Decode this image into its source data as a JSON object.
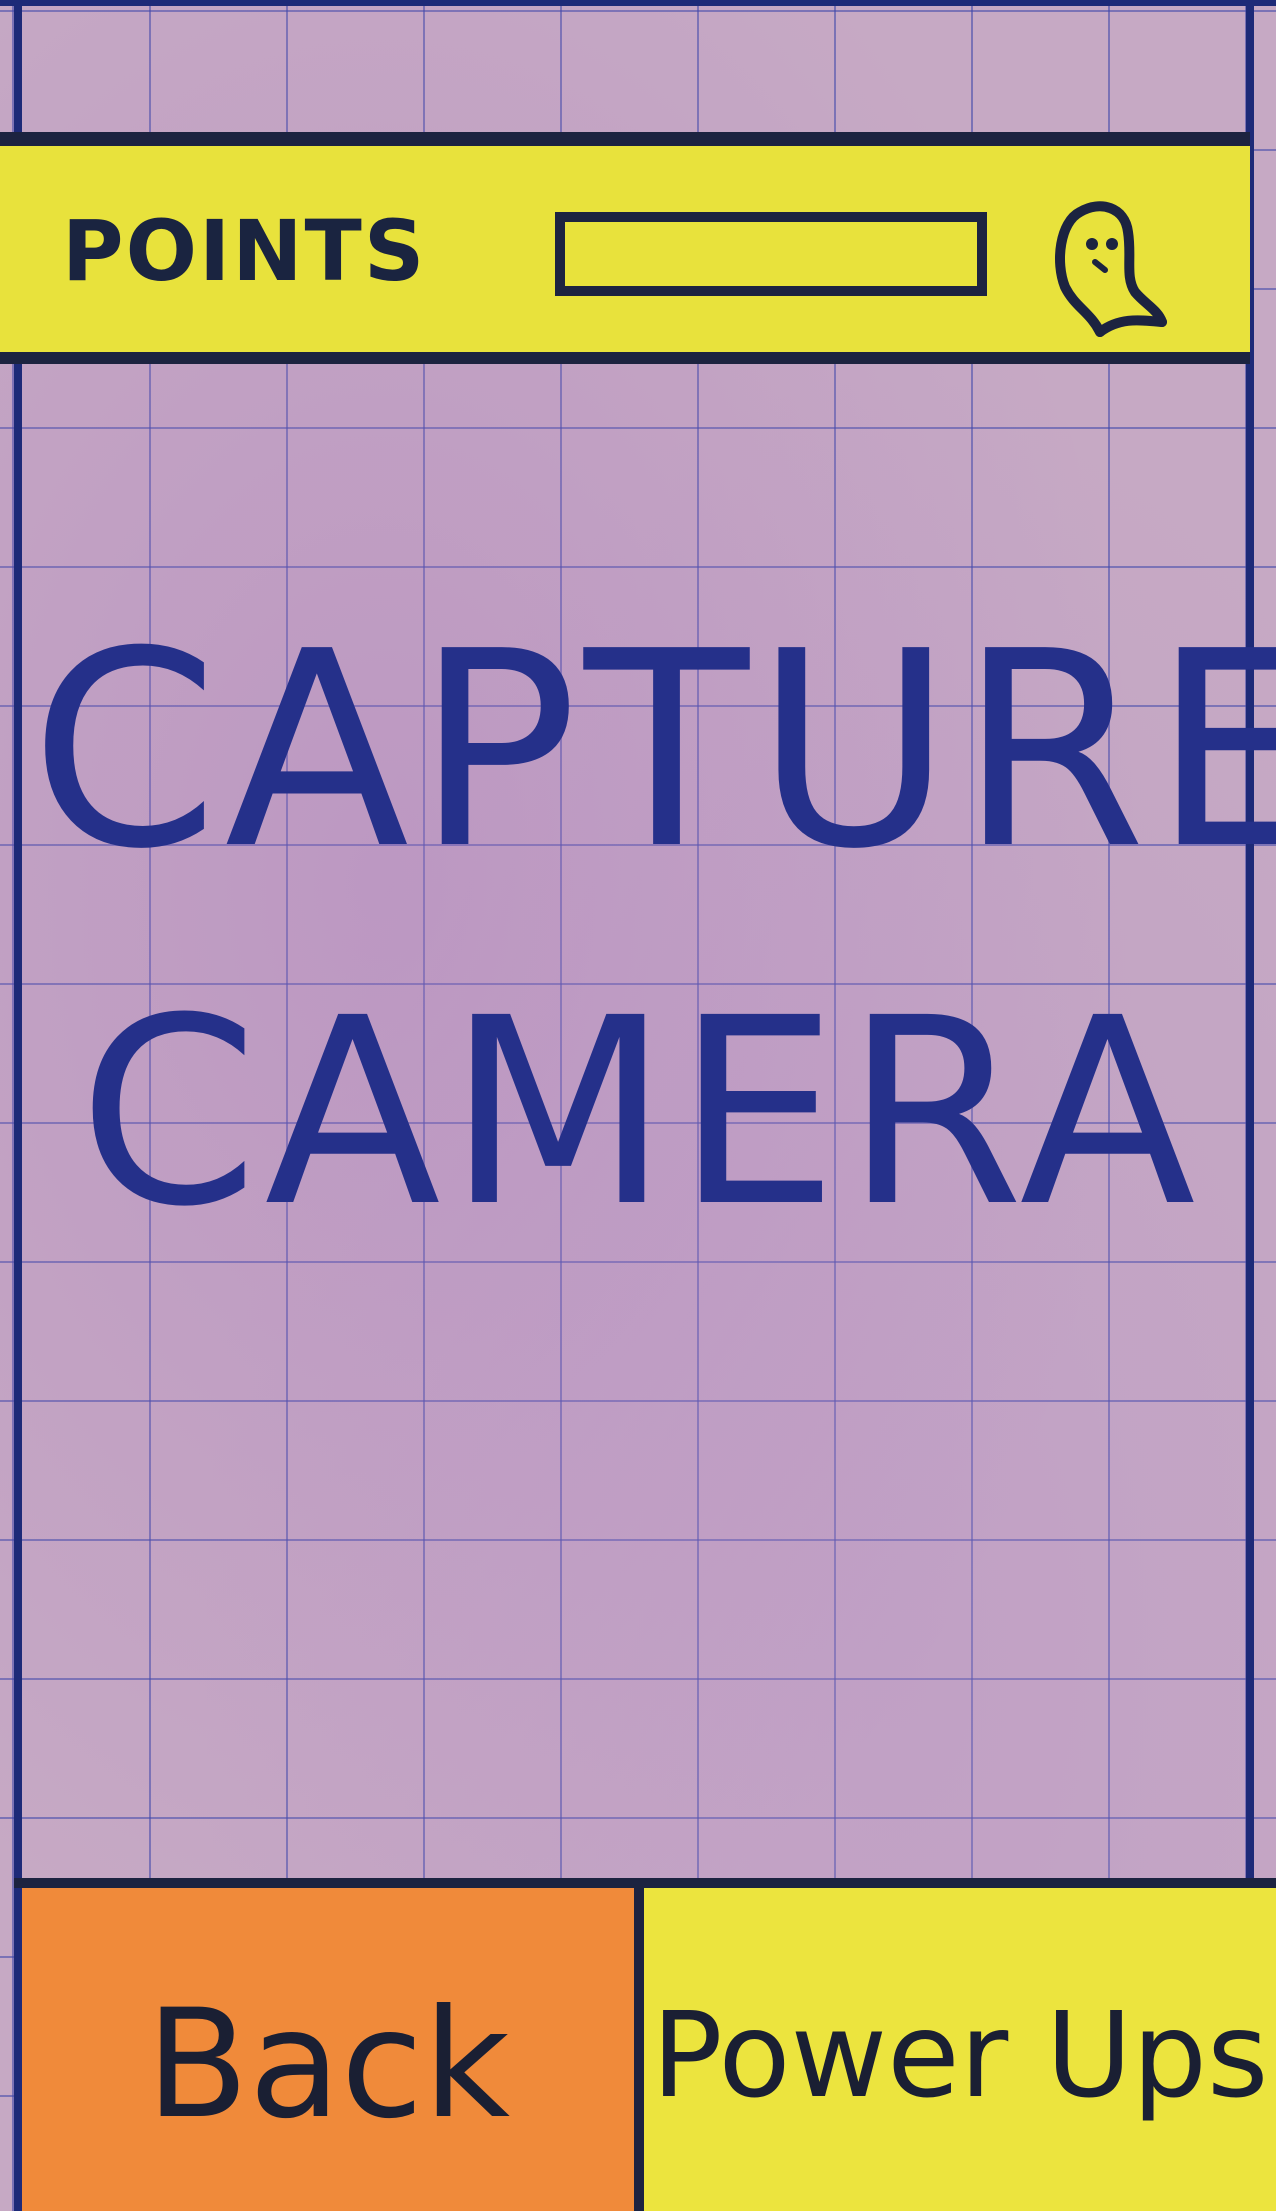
{
  "header": {
    "points_label": "POINTS",
    "points_progress": 0.0,
    "avatar_icon": "user-avatar-icon"
  },
  "main": {
    "title_line_1": "CAPTURE",
    "title_line_2": "CAMERA"
  },
  "footer": {
    "back_label": "Back",
    "powerups_label": "Power Ups"
  },
  "colors": {
    "header_bg": "#e8e23c",
    "main_bg": "#c6a9c4",
    "back_bg": "#f08a3a",
    "powerups_bg": "#ece43e",
    "ink": "#1c2340",
    "title_ink": "#25308a"
  }
}
